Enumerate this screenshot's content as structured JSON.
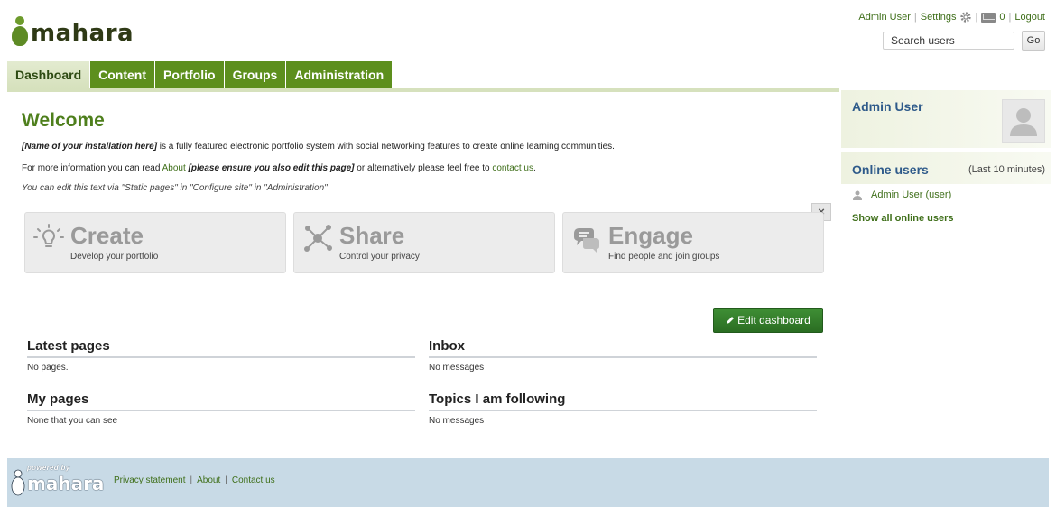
{
  "brand": {
    "logo_text": "mahara",
    "accent": "#5d8f1d"
  },
  "header": {
    "user_link": "Admin User",
    "settings_label": "Settings",
    "message_count": "0",
    "logout_label": "Logout",
    "search": {
      "value": "Search users",
      "go_label": "Go"
    }
  },
  "nav": {
    "tabs": [
      {
        "label": "Dashboard",
        "active": true
      },
      {
        "label": "Content"
      },
      {
        "label": "Portfolio"
      },
      {
        "label": "Groups"
      },
      {
        "label": "Administration"
      }
    ]
  },
  "main": {
    "welcome_title": "Welcome",
    "intro1_bold": "[Name of your installation here]",
    "intro1_rest": " is a fully featured electronic portfolio system with social networking features to create online learning communities.",
    "intro2_pre": "For more information you can read ",
    "intro2_link": "About",
    "intro2_bold": " [please ensure you also edit this page]",
    "intro2_mid": " or alternatively please feel free to ",
    "intro2_contact": "contact us",
    "intro2_end": ".",
    "intro3": "You can edit this text via \"Static pages\" in \"Configure site\" in \"Administration\"",
    "close_icon": "×",
    "features": [
      {
        "title": "Create",
        "subtitle": "Develop your portfolio",
        "icon": "lightbulb-icon"
      },
      {
        "title": "Share",
        "subtitle": "Control your privacy",
        "icon": "share-network-icon"
      },
      {
        "title": "Engage",
        "subtitle": "Find people and join groups",
        "icon": "chat-bubbles-icon"
      }
    ],
    "edit_dashboard_label": "Edit dashboard",
    "blocks": {
      "latest_pages": {
        "title": "Latest pages",
        "text": "No pages."
      },
      "inbox": {
        "title": "Inbox",
        "text": "No messages"
      },
      "my_pages": {
        "title": "My pages",
        "text": "None that you can see"
      },
      "topics": {
        "title": "Topics I am following",
        "text": "No messages"
      }
    }
  },
  "sidebar": {
    "profile_name": "Admin User",
    "online_title": "Online users",
    "online_sub": "(Last 10 minutes)",
    "online_items": [
      "Admin User (user)"
    ],
    "show_all": "Show all online users"
  },
  "footer": {
    "powered_by": "powered by",
    "logo_text": "mahara",
    "links": [
      "Privacy statement",
      "About",
      "Contact us"
    ]
  }
}
